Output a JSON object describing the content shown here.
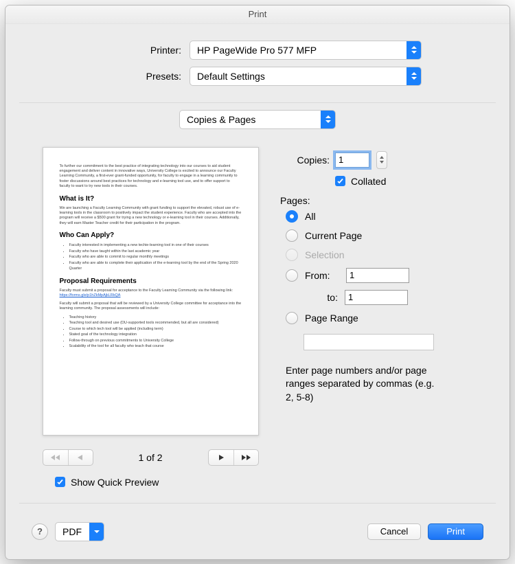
{
  "title": "Print",
  "labels": {
    "printer": "Printer:",
    "presets": "Presets:",
    "copies": "Copies:",
    "collated": "Collated",
    "pages": "Pages:",
    "from": "From:",
    "to": "to:",
    "hint": "Enter page numbers and/or page ranges separated by commas (e.g. 2, 5-8)",
    "quick": "Show Quick Preview"
  },
  "selects": {
    "printer": "HP PageWide Pro 577 MFP",
    "presets": "Default Settings",
    "panel": "Copies & Pages",
    "pdf": "PDF"
  },
  "copies": {
    "value": "1"
  },
  "pagesRadio": {
    "all": "All",
    "current": "Current Page",
    "selection": "Selection",
    "range": "Page Range",
    "from": "1",
    "to": "1"
  },
  "pager": {
    "label": "1 of 2"
  },
  "buttons": {
    "cancel": "Cancel",
    "print": "Print",
    "help": "?"
  },
  "doc": {
    "p1": "To further our commitment to the best practice of integrating technology into our courses to aid student engagement and deliver content in innovative ways, University College is excited to announce our Faculty Learning Community, a first-ever grant-funded opportunity, for faculty to engage in a learning community to foster discussions around best practices for technology and e-learning tool use, and to offer support to faculty to want to try new tools in their courses.",
    "h1": "What is It?",
    "p2": "We are launching a Faculty Learning Community with grant funding to support the elevated, robust use of e-learning tools in the classroom to positively impact the student experience. Faculty who are accepted into the program will receive a $500 grant for trying a new technology or e-learning tool in their courses. Additionally, they will earn Master Teacher credit for their participation in the program.",
    "h2": "Who Can Apply?",
    "b1": "Faculty interested in implementing a new techie-learning tool in one of their courses",
    "b2": "Faculty who have taught within the last academic year",
    "b3": "Faculty who are able to commit to regular monthly meetings",
    "b4": "Faculty who are able to complete their application of the e-learning tool by the end of the Spring 2020 Quarter",
    "h3": "Proposal Requirements",
    "p3a": "Faculty must submit a proposal for acceptance to the Faculty Learning Community via the following link: ",
    "link": "https://forms.gle/p1hZkMpAjkLRkQA",
    "p4": "Faculty will submit a proposal that will be reviewed by a University College committee for acceptance into the learning community. The proposal assessments will include:",
    "c1": "Teaching history",
    "c2": "Teaching tool and desired use (DU-supported tools recommended, but all are considered)",
    "c3": "Course to which tech tool will be applied (including term)",
    "c4": "Stated goal of the technology integration",
    "c5": "Follow-through on previous commitments to University College",
    "c6": "Scalability of the tool for all faculty who teach that course"
  }
}
